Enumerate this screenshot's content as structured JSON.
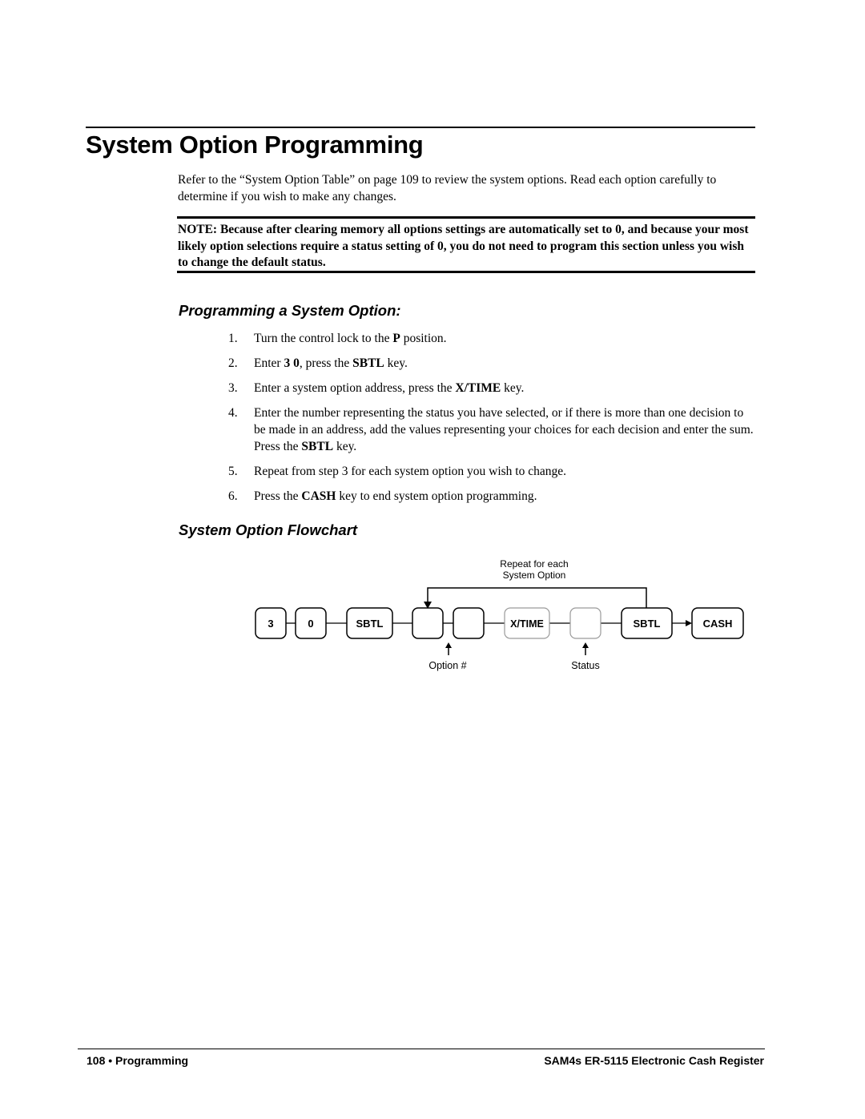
{
  "page": {
    "title": "System Option Programming",
    "intro": "Refer to the “System Option Table” on page 109 to review the system options.  Read each option carefully to determine if you wish to make any changes.",
    "note": "NOTE:  Because after clearing memory all options settings are automatically set to 0, and because your most likely option selections require a status setting of 0, you do not need to program this section unless you wish to change the default status."
  },
  "programming_section": {
    "heading": "Programming a System Option:",
    "steps": [
      {
        "num": "1.",
        "parts": [
          {
            "t": "Turn the control lock to the "
          },
          {
            "t": "P",
            "b": true
          },
          {
            "t": " position."
          }
        ]
      },
      {
        "num": "2.",
        "parts": [
          {
            "t": "Enter "
          },
          {
            "t": "3 0",
            "b": true
          },
          {
            "t": ", press the "
          },
          {
            "t": "SBTL",
            "b": true
          },
          {
            "t": " key."
          }
        ]
      },
      {
        "num": "3.",
        "parts": [
          {
            "t": "Enter a system option address, press the "
          },
          {
            "t": "X/TIME",
            "b": true
          },
          {
            "t": " key."
          }
        ]
      },
      {
        "num": "4.",
        "parts": [
          {
            "t": "Enter the number representing the status you have selected, or if there is more than one decision to be made in an address, add the values representing your choices for each decision and enter the sum.  Press the "
          },
          {
            "t": "SBTL",
            "b": true
          },
          {
            "t": " key."
          }
        ]
      },
      {
        "num": "5.",
        "parts": [
          {
            "t": "Repeat from step 3 for each system option you wish to change."
          }
        ]
      },
      {
        "num": "6.",
        "parts": [
          {
            "t": "Press the "
          },
          {
            "t": "CASH",
            "b": true
          },
          {
            "t": " key to end system option programming."
          }
        ]
      }
    ]
  },
  "flowchart_section": {
    "heading": "System Option Flowchart",
    "repeat_label_line1": "Repeat for each",
    "repeat_label_line2": "System Option",
    "keys": {
      "k3": "3",
      "k0": "0",
      "sbtl1": "SBTL",
      "blank1": "",
      "blank2": "",
      "xtime": "X/TIME",
      "status_box": "",
      "sbtl2": "SBTL",
      "cash": "CASH"
    },
    "option_label": "Option #",
    "status_label": "Status"
  },
  "footer": {
    "left": "108  •  Programming",
    "right": "SAM4s ER-5115 Electronic Cash Register"
  }
}
